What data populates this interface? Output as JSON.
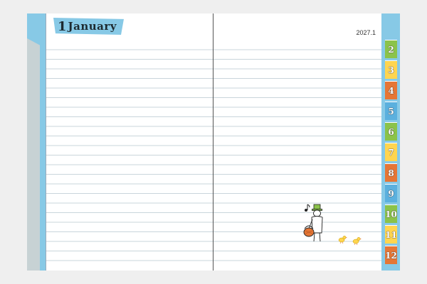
{
  "header": {
    "month_number": "1",
    "month_name": "January",
    "year_month": "2027.1"
  },
  "tabs": [
    {
      "label": "2",
      "color": "#8bc34a"
    },
    {
      "label": "3",
      "color": "#ffd54f"
    },
    {
      "label": "4",
      "color": "#e57635"
    },
    {
      "label": "5",
      "color": "#5bb0de"
    },
    {
      "label": "6",
      "color": "#8bc34a"
    },
    {
      "label": "7",
      "color": "#ffd54f"
    },
    {
      "label": "8",
      "color": "#e57635"
    },
    {
      "label": "9",
      "color": "#5bb0de"
    },
    {
      "label": "10",
      "color": "#8bc34a"
    },
    {
      "label": "11",
      "color": "#ffd54f"
    },
    {
      "label": "12",
      "color": "#e57635"
    }
  ],
  "colors": {
    "cover": "#87c9e6",
    "rule": "#c9d5db",
    "accent_green": "#8bc34a",
    "accent_orange": "#e57635"
  },
  "illustration": {
    "icon": "character-with-basket-and-chicks-icon"
  }
}
